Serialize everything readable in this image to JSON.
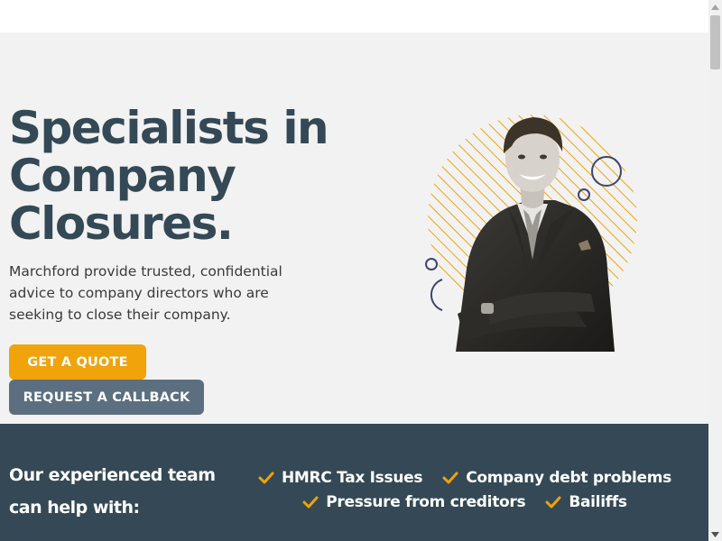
{
  "hero": {
    "headline_line1": "Specialists in",
    "headline_line2": "Company",
    "headline_line3": "Closures.",
    "lead": "Marchford provide trusted, confidential advice to company directors who are seeking to close their company.",
    "quote_button": "GET A QUOTE",
    "callback_button": "REQUEST A CALLBACK",
    "image_alt": "Smiling man in suit with arms crossed"
  },
  "help": {
    "title_line1": "Our experienced team",
    "title_line2": "can help with:",
    "services": [
      "HMRC Tax Issues",
      "Company debt problems",
      "Pressure from creditors",
      "Bailiffs"
    ]
  },
  "colors": {
    "brand_dark": "#344955",
    "accent": "#f0a30a",
    "secondary_button": "#5b6f80",
    "hero_bg": "#f2f2f2"
  },
  "icons": {
    "service_check": "check-icon",
    "scroll_up": "arrow-up-icon",
    "scroll_down": "arrow-down-icon"
  }
}
